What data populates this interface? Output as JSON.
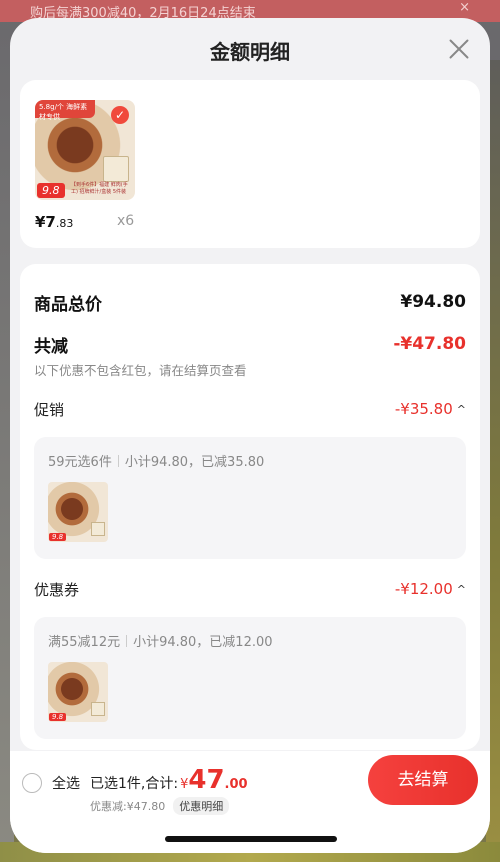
{
  "background": {
    "banner_text": "购后每满300减40，2月16日24点结束",
    "banner_close": "×"
  },
  "sheet": {
    "title": "金额明细"
  },
  "product": {
    "thumb_tag": "5.8g/个 海鲜素材专供",
    "thumb_price": "9.8",
    "thumb_caption": "【到手6件】福建 鲜肉(手工) 招牌鲜汁/盒装 5件装",
    "price_symbol_int": "¥7",
    "price_dec": ".83",
    "quantity": "x6"
  },
  "summary": {
    "total_label": "商品总价",
    "total_value": "¥94.80",
    "reduce_label": "共减",
    "reduce_value": "-¥47.80",
    "note": "以下优惠不包含红包，请在结算页查看"
  },
  "promotions": [
    {
      "label": "促销",
      "value": "-¥35.80",
      "rule": "59元选6件",
      "detail": "小计94.80，已减35.80",
      "thumb_price": "9.8"
    },
    {
      "label": "优惠券",
      "value": "-¥12.00",
      "rule": "满55减12元",
      "detail": "小计94.80，已减12.00",
      "thumb_price": "9.8"
    }
  ],
  "bottom": {
    "select_all": "全选",
    "selected_text": "已选1件,合计:",
    "currency": "¥",
    "total_int": "47",
    "total_dec": ".00",
    "discount_text": "优惠减:¥47.80",
    "detail_pill": "优惠明细",
    "checkout": "去结算"
  },
  "colors": {
    "accent": "#e8312c",
    "sheet_bg": "#f2f2f4"
  }
}
